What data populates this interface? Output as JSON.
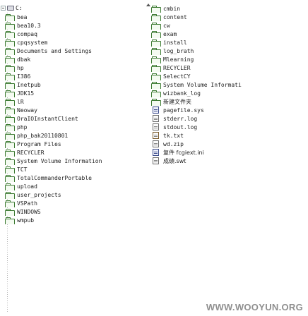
{
  "tree": {
    "root_label": "C:",
    "left_items": [
      {
        "label": "bea",
        "icon": "folder-icon"
      },
      {
        "label": "bea10.3",
        "icon": "folder-icon"
      },
      {
        "label": "compaq",
        "icon": "folder-icon"
      },
      {
        "label": "cpqsystem",
        "icon": "folder-icon"
      },
      {
        "label": "Documents and Settings",
        "icon": "folder-icon"
      },
      {
        "label": "dbak",
        "icon": "folder-icon"
      },
      {
        "label": "hp",
        "icon": "folder-icon"
      },
      {
        "label": "I386",
        "icon": "folder-icon"
      },
      {
        "label": "Inetpub",
        "icon": "folder-icon"
      },
      {
        "label": "JDK15",
        "icon": "folder-icon"
      },
      {
        "label": "lR",
        "icon": "folder-icon"
      },
      {
        "label": "Neoway",
        "icon": "folder-icon"
      },
      {
        "label": "OraIOInstantClient",
        "icon": "folder-icon"
      },
      {
        "label": "php",
        "icon": "folder-icon"
      },
      {
        "label": "php_bak20110801",
        "icon": "folder-icon"
      },
      {
        "label": "Program Files",
        "icon": "folder-icon"
      },
      {
        "label": "RECYCLER",
        "icon": "folder-icon"
      },
      {
        "label": "System Volume Information",
        "icon": "folder-icon"
      },
      {
        "label": "TCT",
        "icon": "folder-icon"
      },
      {
        "label": "TotalCommanderPortable",
        "icon": "folder-icon"
      },
      {
        "label": "upload",
        "icon": "folder-icon"
      },
      {
        "label": "user_projects",
        "icon": "folder-icon"
      },
      {
        "label": "VSPath",
        "icon": "folder-icon"
      },
      {
        "label": "WINDOWS",
        "icon": "folder-icon"
      },
      {
        "label": "wmpub",
        "icon": "folder-icon"
      }
    ],
    "right_items": [
      {
        "label": "cmbin",
        "icon": "folder-icon"
      },
      {
        "label": "content",
        "icon": "folder-icon"
      },
      {
        "label": "cw",
        "icon": "folder-icon"
      },
      {
        "label": "exam",
        "icon": "folder-icon"
      },
      {
        "label": "install",
        "icon": "folder-icon"
      },
      {
        "label": "log_brath",
        "icon": "folder-icon"
      },
      {
        "label": "Mlearning",
        "icon": "folder-icon"
      },
      {
        "label": "RECYCLER",
        "icon": "folder-icon"
      },
      {
        "label": "SelectCY",
        "icon": "folder-icon"
      },
      {
        "label": "System Volume Informati",
        "icon": "folder-icon"
      },
      {
        "label": "wizbank_log",
        "icon": "folder-icon"
      },
      {
        "label": "新建文件夹",
        "icon": "folder-icon"
      },
      {
        "label": "pagefile.sys",
        "icon": "system-file-icon"
      },
      {
        "label": "stderr.log",
        "icon": "file-icon"
      },
      {
        "label": "stdout.log",
        "icon": "file-icon"
      },
      {
        "label": "tk.txt",
        "icon": "text-file-icon"
      },
      {
        "label": "wd.zip",
        "icon": "file-icon"
      },
      {
        "label": "复件 fcgiext.ini",
        "icon": "config-file-icon"
      },
      {
        "label": "成绩.swt",
        "icon": "file-icon"
      }
    ]
  },
  "watermark": "WWW.WOOYUN.ORG"
}
